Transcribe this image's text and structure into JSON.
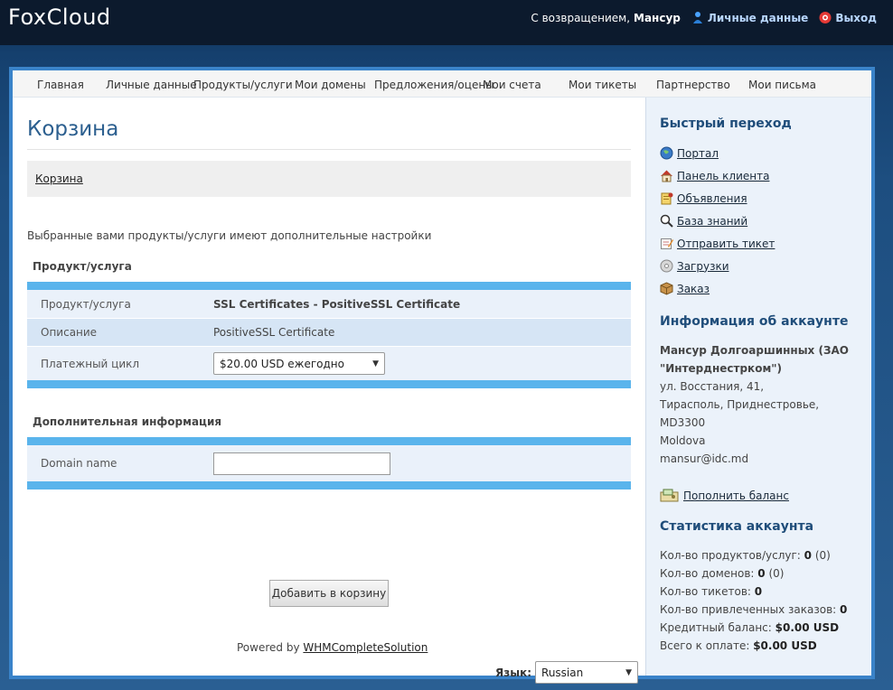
{
  "header": {
    "brand": "FoxCloud",
    "welcome": "С возвращением,",
    "username": "Мансур",
    "profile_link": "Личные данные",
    "logout_link": "Выход"
  },
  "nav": {
    "items": [
      "Главная",
      "Личные данные",
      "Продукты/услуги",
      "Мои домены",
      "Предложения/оцены",
      "Мои счета",
      "Мои тикеты",
      "Партнерство",
      "Мои письма"
    ]
  },
  "main": {
    "title": "Корзина",
    "breadcrumb": "Корзина",
    "intro": "Выбранные вами продукты/услуги имеют дополнительные настройки",
    "product_section": "Продукт/услуга",
    "product_rows": [
      {
        "label": "Продукт/услуга",
        "value": "SSL Certificates - PositiveSSL Certificate"
      },
      {
        "label": "Описание",
        "value": "PositiveSSL Certificate"
      },
      {
        "label": "Платежный цикл",
        "value": "$20.00 USD ежегодно"
      }
    ],
    "extra_section": "Дополнительная информация",
    "domain_label": "Domain name",
    "domain_value": "",
    "add_button": "Добавить в корзину",
    "powered_prefix": "Powered by",
    "powered_link": "WHMCompleteSolution",
    "language_label": "Язык:",
    "language_value": "Russian"
  },
  "sidebar": {
    "quick_title": "Быстрый переход",
    "quick_links": [
      {
        "label": "Портал",
        "icon": "globe-icon"
      },
      {
        "label": "Панель клиента",
        "icon": "home-icon"
      },
      {
        "label": "Объявления",
        "icon": "announcement-icon"
      },
      {
        "label": "База знаний",
        "icon": "search-icon"
      },
      {
        "label": "Отправить тикет",
        "icon": "ticket-icon"
      },
      {
        "label": "Загрузки",
        "icon": "disc-icon"
      },
      {
        "label": "Заказ",
        "icon": "box-icon"
      }
    ],
    "account_title": "Информация об аккаунте",
    "account_name": "Мансур Долгоаршинных (ЗАО \"Интерднестрком\")",
    "account_lines": [
      "ул. Восстания, 41,",
      "Тирасполь, Приднестровье,",
      "MD3300",
      "Moldova",
      "mansur@idc.md"
    ],
    "topup_link": "Пополнить баланс",
    "stats_title": "Статистика аккаунта",
    "stats": [
      {
        "label": "Кол-во продуктов/услуг:",
        "value": "0",
        "extra": "(0)"
      },
      {
        "label": "Кол-во доменов:",
        "value": "0",
        "extra": "(0)"
      },
      {
        "label": "Кол-во тикетов:",
        "value": "0",
        "extra": ""
      },
      {
        "label": "Кол-во привлеченных заказов:",
        "value": "0",
        "extra": ""
      },
      {
        "label": "Кредитный баланс:",
        "value": "$0.00 USD",
        "extra": ""
      },
      {
        "label": "Всего к оплате:",
        "value": "$0.00 USD",
        "extra": ""
      }
    ]
  }
}
